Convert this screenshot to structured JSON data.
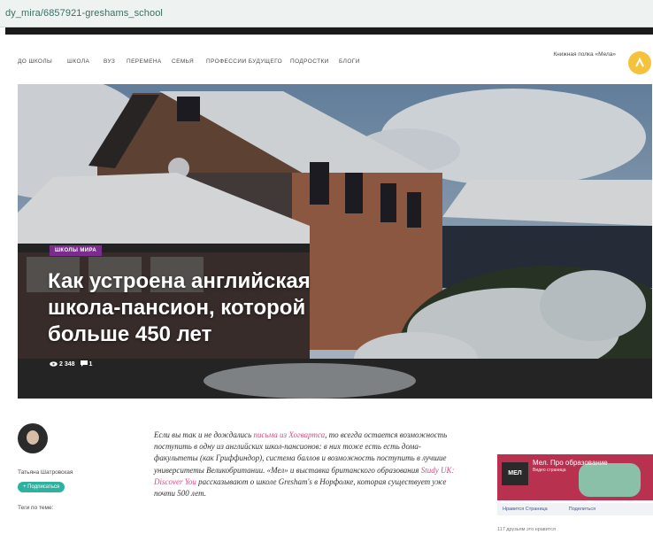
{
  "browser": {
    "url": "dy_mira/6857921-greshams_school"
  },
  "nav": {
    "items": [
      "До школы",
      "Школа",
      "ВУЗ",
      "Перемена",
      "Семья",
      "Профессии будущего",
      "Подростки",
      "Блоги"
    ],
    "promo_text": "Книжная полка «Мела»"
  },
  "hero": {
    "tag": "Школы мира",
    "title": "Как устроена английская школа-пансион, которой больше 450 лет",
    "views": "2 348",
    "comments": "1"
  },
  "author": {
    "name": "Татьяна Шатровская",
    "follow_label": "+ Подписаться",
    "tags_label": "Теги по теме:"
  },
  "lead": {
    "part1": "Если вы так и не дождались ",
    "link1": "письма из Хогвартса",
    "part2": ", то всегда остается возможность поступить в одну из английских школ-пансионов: в них тоже есть есть дома-факультеты (как Гриффиндор), система баллов и возможность поступить в лучшие университеты Великобритании. «Мел» и выставка британского образования ",
    "link2": "Study UK: Discover You",
    "part3": " рассказывают о школе Gresham's в Норфолке, которая существует уже почти 500 лет."
  },
  "ad": {
    "logo": "МЕЛ",
    "headline": "Мел. Про образование",
    "subline": "Видео страница",
    "fb_left": "Нравится Страница",
    "fb_right": "Поделиться",
    "more": "117 друзьям это нравится"
  },
  "colors": {
    "tag_purple": "#7a2d8c",
    "link_pink": "#e0468a",
    "follow_teal": "#2bb3a0",
    "promo_yellow": "#f5c23c",
    "ad_red": "#b8314e"
  }
}
